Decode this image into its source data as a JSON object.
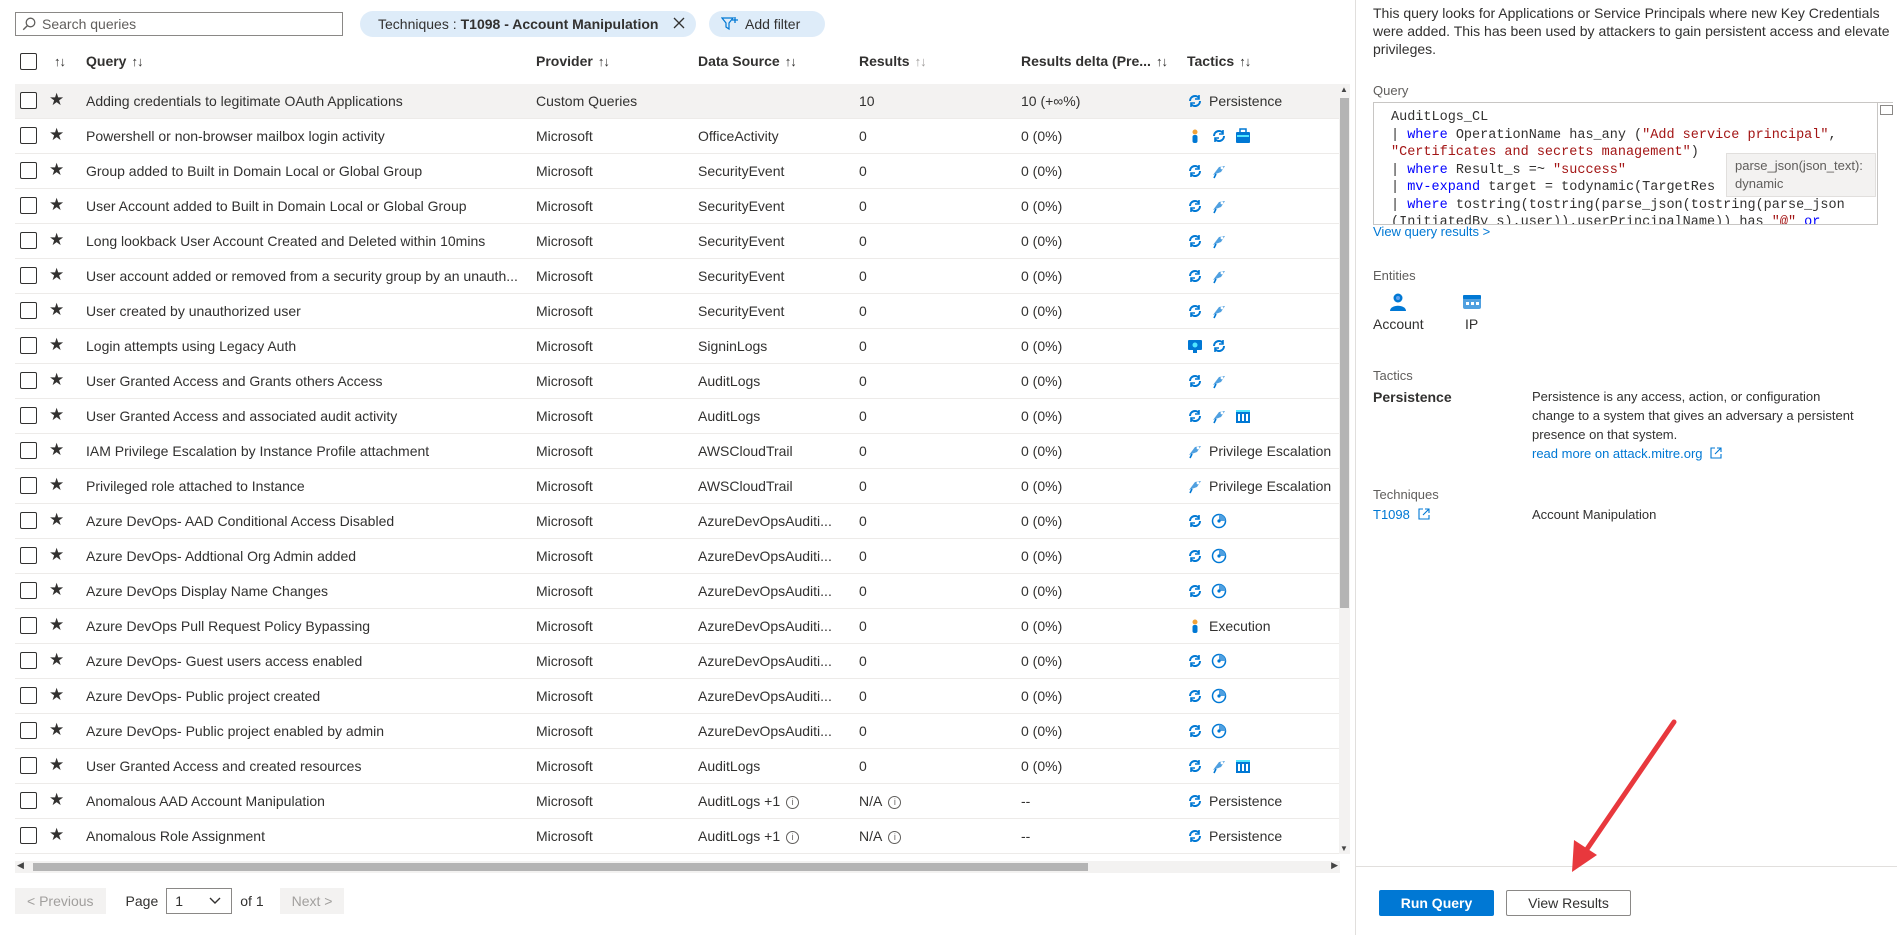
{
  "toolbar": {
    "search_placeholder": "Search queries",
    "filter_prefix": "Techniques :",
    "filter_value": "T1098 - Account Manipulation",
    "add_filter_label": "Add filter"
  },
  "columns": {
    "query": "Query",
    "provider": "Provider",
    "data_source": "Data Source",
    "results": "Results",
    "results_delta": "Results delta (Pre...",
    "tactics": "Tactics"
  },
  "rows": [
    {
      "query": "Adding credentials to legitimate OAuth Applications",
      "provider": "Custom Queries",
      "data_source": "",
      "results": "10",
      "delta": "10 (+∞%)",
      "tactics": [
        "persistence"
      ],
      "tactic_label": "Persistence"
    },
    {
      "query": "Powershell or non-browser mailbox login activity",
      "provider": "Microsoft",
      "data_source": "OfficeActivity",
      "results": "0",
      "delta": "0 (0%)",
      "tactics": [
        "execution",
        "persistence",
        "collection"
      ],
      "tactic_label": ""
    },
    {
      "query": "Group added to Built in Domain Local or Global Group",
      "provider": "Microsoft",
      "data_source": "SecurityEvent",
      "results": "0",
      "delta": "0 (0%)",
      "tactics": [
        "persistence",
        "privilege-escalation"
      ],
      "tactic_label": ""
    },
    {
      "query": "User Account added to Built in Domain Local or Global Group",
      "provider": "Microsoft",
      "data_source": "SecurityEvent",
      "results": "0",
      "delta": "0 (0%)",
      "tactics": [
        "persistence",
        "privilege-escalation"
      ],
      "tactic_label": ""
    },
    {
      "query": "Long lookback User Account Created and Deleted within 10mins",
      "provider": "Microsoft",
      "data_source": "SecurityEvent",
      "results": "0",
      "delta": "0 (0%)",
      "tactics": [
        "persistence",
        "privilege-escalation"
      ],
      "tactic_label": ""
    },
    {
      "query": "User account added or removed from a security group by an unauth...",
      "provider": "Microsoft",
      "data_source": "SecurityEvent",
      "results": "0",
      "delta": "0 (0%)",
      "tactics": [
        "persistence",
        "privilege-escalation"
      ],
      "tactic_label": ""
    },
    {
      "query": "User created by unauthorized user",
      "provider": "Microsoft",
      "data_source": "SecurityEvent",
      "results": "0",
      "delta": "0 (0%)",
      "tactics": [
        "persistence",
        "privilege-escalation"
      ],
      "tactic_label": ""
    },
    {
      "query": "Login attempts using Legacy Auth",
      "provider": "Microsoft",
      "data_source": "SigninLogs",
      "results": "0",
      "delta": "0 (0%)",
      "tactics": [
        "initial-access",
        "persistence"
      ],
      "tactic_label": ""
    },
    {
      "query": "User Granted Access and Grants others Access",
      "provider": "Microsoft",
      "data_source": "AuditLogs",
      "results": "0",
      "delta": "0 (0%)",
      "tactics": [
        "persistence",
        "privilege-escalation"
      ],
      "tactic_label": ""
    },
    {
      "query": "User Granted Access and associated audit activity",
      "provider": "Microsoft",
      "data_source": "AuditLogs",
      "results": "0",
      "delta": "0 (0%)",
      "tactics": [
        "persistence",
        "privilege-escalation",
        "impact"
      ],
      "tactic_label": ""
    },
    {
      "query": "IAM Privilege Escalation by Instance Profile attachment",
      "provider": "Microsoft",
      "data_source": "AWSCloudTrail",
      "results": "0",
      "delta": "0 (0%)",
      "tactics": [
        "privilege-escalation"
      ],
      "tactic_label": "Privilege Escalation"
    },
    {
      "query": "Privileged role attached to Instance",
      "provider": "Microsoft",
      "data_source": "AWSCloudTrail",
      "results": "0",
      "delta": "0 (0%)",
      "tactics": [
        "privilege-escalation"
      ],
      "tactic_label": "Privilege Escalation"
    },
    {
      "query": "Azure DevOps- AAD Conditional Access Disabled",
      "provider": "Microsoft",
      "data_source": "AzureDevOpsAuditi...",
      "results": "0",
      "delta": "0 (0%)",
      "tactics": [
        "persistence",
        "defense-evasion"
      ],
      "tactic_label": ""
    },
    {
      "query": "Azure DevOps- Addtional Org Admin added",
      "provider": "Microsoft",
      "data_source": "AzureDevOpsAuditi...",
      "results": "0",
      "delta": "0 (0%)",
      "tactics": [
        "persistence",
        "defense-evasion"
      ],
      "tactic_label": ""
    },
    {
      "query": "Azure DevOps Display Name Changes",
      "provider": "Microsoft",
      "data_source": "AzureDevOpsAuditi...",
      "results": "0",
      "delta": "0 (0%)",
      "tactics": [
        "persistence",
        "defense-evasion"
      ],
      "tactic_label": ""
    },
    {
      "query": "Azure DevOps Pull Request Policy Bypassing",
      "provider": "Microsoft",
      "data_source": "AzureDevOpsAuditi...",
      "results": "0",
      "delta": "0 (0%)",
      "tactics": [
        "execution"
      ],
      "tactic_label": "Execution"
    },
    {
      "query": "Azure DevOps- Guest users access enabled",
      "provider": "Microsoft",
      "data_source": "AzureDevOpsAuditi...",
      "results": "0",
      "delta": "0 (0%)",
      "tactics": [
        "persistence",
        "defense-evasion"
      ],
      "tactic_label": ""
    },
    {
      "query": "Azure DevOps- Public project created",
      "provider": "Microsoft",
      "data_source": "AzureDevOpsAuditi...",
      "results": "0",
      "delta": "0 (0%)",
      "tactics": [
        "persistence",
        "defense-evasion"
      ],
      "tactic_label": ""
    },
    {
      "query": "Azure DevOps- Public project enabled by admin",
      "provider": "Microsoft",
      "data_source": "AzureDevOpsAuditi...",
      "results": "0",
      "delta": "0 (0%)",
      "tactics": [
        "persistence",
        "defense-evasion"
      ],
      "tactic_label": ""
    },
    {
      "query": "User Granted Access and created resources",
      "provider": "Microsoft",
      "data_source": "AuditLogs",
      "results": "0",
      "delta": "0 (0%)",
      "tactics": [
        "persistence",
        "privilege-escalation",
        "impact"
      ],
      "tactic_label": ""
    },
    {
      "query": "Anomalous AAD Account Manipulation",
      "provider": "Microsoft",
      "data_source": "AuditLogs +1",
      "results": "N/A",
      "delta": "--",
      "tactics": [
        "persistence"
      ],
      "tactic_label": "Persistence",
      "info": true
    },
    {
      "query": "Anomalous Role Assignment",
      "provider": "Microsoft",
      "data_source": "AuditLogs +1",
      "results": "N/A",
      "delta": "--",
      "tactics": [
        "persistence"
      ],
      "tactic_label": "Persistence",
      "info": true
    }
  ],
  "pager": {
    "previous": "< Previous",
    "page_label": "Page",
    "page_value": "1",
    "of_label": "of 1",
    "next": "Next >"
  },
  "details": {
    "description": "This query looks for Applications or Service Principals where new Key Credentials were added. This has been used by attackers to gain persistent access and elevate privileges.",
    "query_label": "Query",
    "code_lines": [
      [
        {
          "t": "AuditLogs_CL",
          "c": ""
        }
      ],
      [
        {
          "t": "| ",
          "c": "pipe"
        },
        {
          "t": "where",
          "c": "kw"
        },
        {
          "t": " OperationName has_any (",
          "c": ""
        },
        {
          "t": "\"Add service principal\"",
          "c": "str"
        },
        {
          "t": ",",
          "c": ""
        }
      ],
      [
        {
          "t": "\"Certificates and secrets management\"",
          "c": "str"
        },
        {
          "t": ")",
          "c": ""
        }
      ],
      [
        {
          "t": "| ",
          "c": "pipe"
        },
        {
          "t": "where",
          "c": "kw"
        },
        {
          "t": " Result_s =~ ",
          "c": ""
        },
        {
          "t": "\"success\"",
          "c": "str"
        }
      ],
      [
        {
          "t": "| ",
          "c": "pipe"
        },
        {
          "t": "mv-expand",
          "c": "kw"
        },
        {
          "t": " target = todynamic(TargetRes",
          "c": ""
        }
      ],
      [
        {
          "t": "| ",
          "c": "pipe"
        },
        {
          "t": "where",
          "c": "kw"
        },
        {
          "t": " tostring(tostring(parse_json(tostring(parse_json",
          "c": ""
        }
      ],
      [
        {
          "t": "(InitiatedBy_s).user)).userPrincipalName)) has ",
          "c": ""
        },
        {
          "t": "\"@\"",
          "c": "str"
        },
        {
          "t": " or",
          "c": "kw"
        }
      ]
    ],
    "tooltip_line1": "parse_json(json_text):",
    "tooltip_line2": "dynamic",
    "view_results_link": "View query results >",
    "entities_label": "Entities",
    "entities": [
      {
        "name": "Account",
        "icon": "account-icon"
      },
      {
        "name": "IP",
        "icon": "ip-icon"
      }
    ],
    "tactics_label": "Tactics",
    "tactic_name": "Persistence",
    "tactic_description": "Persistence is any access, action, or configuration change to a system that gives an adversary a persistent presence on that system.",
    "tactic_link": "read more on attack.mitre.org",
    "techniques_label": "Techniques",
    "technique_id": "T1098",
    "technique_name": "Account Manipulation"
  },
  "footer": {
    "run_query": "Run Query",
    "view_results": "View Results"
  },
  "colors": {
    "accent": "#0078d4",
    "pill_bg": "#deecf9",
    "annotation_arrow": "#e8383d"
  }
}
